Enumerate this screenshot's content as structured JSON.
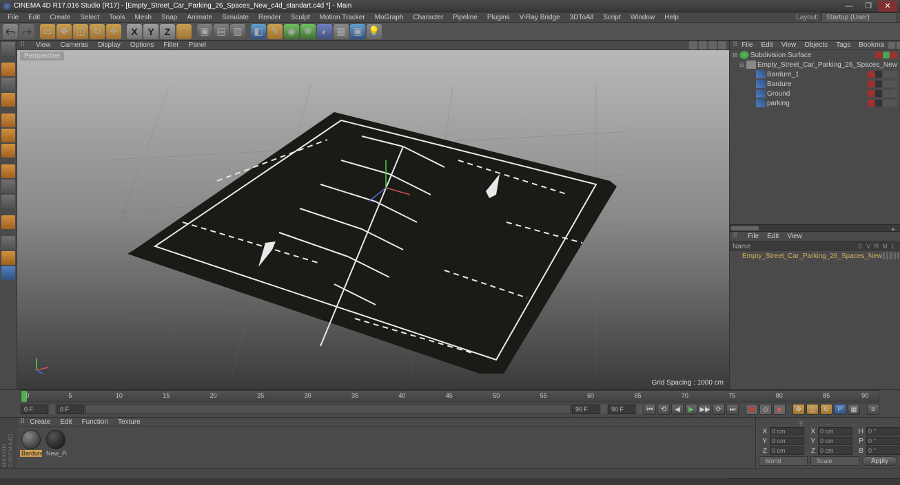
{
  "title": "CINEMA 4D R17.016 Studio (R17) - [Empty_Street_Car_Parking_26_Spaces_New_c4d_standart.c4d *] - Main",
  "menubar": [
    "File",
    "Edit",
    "Create",
    "Select",
    "Tools",
    "Mesh",
    "Snap",
    "Animate",
    "Simulate",
    "Render",
    "Sculpt",
    "Motion Tracker",
    "MoGraph",
    "Character",
    "Pipeline",
    "Plugins",
    "V-Ray Bridge",
    "3DToAll",
    "Script",
    "Window",
    "Help"
  ],
  "layout_label": "Layout:",
  "layout_value": "Startup (User)",
  "viewport_menu": [
    "View",
    "Cameras",
    "Display",
    "Options",
    "Filter",
    "Panel"
  ],
  "viewport_label": "Perspective",
  "grid_spacing": "Grid Spacing : 1000 cm",
  "objects_menu": [
    "File",
    "Edit",
    "View",
    "Objects",
    "Tags",
    "Bookma"
  ],
  "tree": {
    "root": "Subdivision Surface",
    "null": "Empty_Street_Car_Parking_26_Spaces_New",
    "children": [
      "Bardure_1",
      "Bardure",
      "Ground",
      "parking"
    ]
  },
  "takes_menu": [
    "File",
    "Edit",
    "View"
  ],
  "takes_header": "Name",
  "takes_cols": [
    "S",
    "V",
    "R",
    "M",
    "L"
  ],
  "take_item": "Empty_Street_Car_Parking_26_Spaces_New",
  "timeline": {
    "start_field": "0 F",
    "range_start": "0 F",
    "range_end": "90 F",
    "end_field": "90 F",
    "ticks": [
      "0",
      "5",
      "10",
      "15",
      "20",
      "25",
      "30",
      "35",
      "40",
      "45",
      "50",
      "55",
      "60",
      "65",
      "70",
      "75",
      "80",
      "85",
      "90"
    ]
  },
  "materials_menu": [
    "Create",
    "Edit",
    "Function",
    "Texture"
  ],
  "materials": [
    {
      "name": "Bardure",
      "selected": true
    },
    {
      "name": "New_Pa",
      "selected": false
    }
  ],
  "coords": {
    "rows": [
      {
        "a": "X",
        "av": "0 cm",
        "b": "X",
        "bv": "0 cm",
        "c": "H",
        "cv": "0 °"
      },
      {
        "a": "Y",
        "av": "0 cm",
        "b": "Y",
        "bv": "0 cm",
        "c": "P",
        "cv": "0 °"
      },
      {
        "a": "Z",
        "av": "0 cm",
        "b": "Z",
        "bv": "0 cm",
        "c": "B",
        "cv": "0 °"
      }
    ],
    "mode1": "World",
    "mode2": "Scale",
    "apply": "Apply"
  },
  "maxon": "MAXON CINEMA4D"
}
